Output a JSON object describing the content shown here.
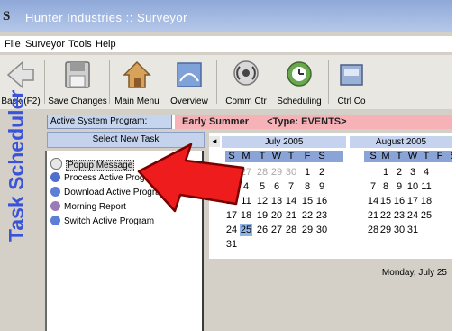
{
  "window": {
    "title": "Hunter Industries :: Surveyor",
    "logo": "S"
  },
  "menu": [
    "File",
    "Surveyor",
    "Tools",
    "Help"
  ],
  "toolbar": [
    {
      "label": "Back (F2)",
      "icon": "back-arrow-icon"
    },
    {
      "label": "Save Changes",
      "icon": "floppy-disk-icon"
    },
    {
      "label": "Main Menu",
      "icon": "house-icon"
    },
    {
      "label": "Overview",
      "icon": "overview-icon"
    },
    {
      "label": "Comm Ctr",
      "icon": "antenna-icon"
    },
    {
      "label": "Scheduling",
      "icon": "scheduling-clock-icon"
    },
    {
      "label": "Ctrl Co",
      "icon": "controller-icon"
    }
  ],
  "side_label": "Task Scheduler",
  "program": {
    "label": "Active System Program:",
    "name": "Early Summer",
    "type": "<Type: EVENTS>"
  },
  "task_panel": {
    "header": "Select New Task",
    "items": [
      {
        "label": "Popup Message",
        "selected": true
      },
      {
        "label": "Process Active Program"
      },
      {
        "label": "Download Active Program"
      },
      {
        "label": "Morning Report"
      },
      {
        "label": "Switch Active Program"
      }
    ]
  },
  "calendar": {
    "prev_icon": "◄",
    "months": [
      {
        "title": "July 2005",
        "dow": [
          "S",
          "M",
          "T",
          "W",
          "T",
          "F",
          "S"
        ],
        "weeks": [
          [
            "26",
            "27",
            "28",
            "29",
            "30",
            "1",
            "2"
          ],
          [
            "3",
            "4",
            "5",
            "6",
            "7",
            "8",
            "9"
          ],
          [
            "10",
            "11",
            "12",
            "13",
            "14",
            "15",
            "16"
          ],
          [
            "17",
            "18",
            "19",
            "20",
            "21",
            "22",
            "23"
          ],
          [
            "24",
            "25",
            "26",
            "27",
            "28",
            "29",
            "30"
          ],
          [
            "31",
            "",
            "",
            "",
            "",
            "",
            ""
          ]
        ],
        "today": "25"
      },
      {
        "title": "August 2005",
        "dow": [
          "S",
          "M",
          "T",
          "W",
          "T",
          "F",
          "S"
        ],
        "weeks": [
          [
            "",
            "1",
            "2",
            "3",
            "4",
            "",
            ""
          ],
          [
            "7",
            "8",
            "9",
            "10",
            "11",
            "",
            ""
          ],
          [
            "14",
            "15",
            "16",
            "17",
            "18",
            "",
            ""
          ],
          [
            "21",
            "22",
            "23",
            "24",
            "25",
            "",
            ""
          ],
          [
            "28",
            "29",
            "30",
            "31",
            "",
            "",
            ""
          ]
        ]
      }
    ],
    "footer": "Monday, July 25"
  },
  "colors": {
    "accent": "#3a53d8",
    "program_value_bg": "#f7b2b8",
    "arrow": "#ee1c1c"
  }
}
